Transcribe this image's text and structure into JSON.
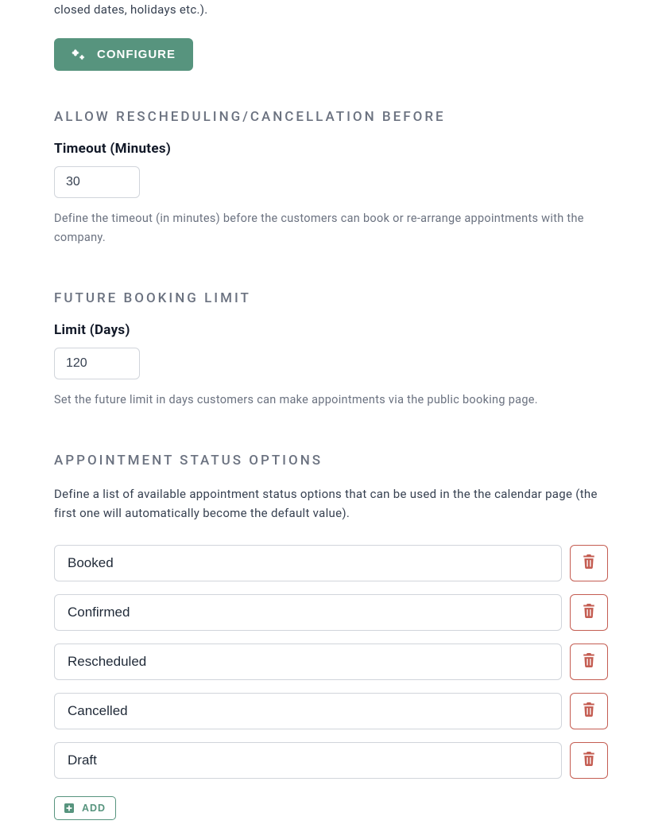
{
  "intro_fragment": "closed dates, holidays etc.).",
  "configure_label": "CONFIGURE",
  "sections": {
    "reschedule": {
      "heading": "ALLOW RESCHEDULING/CANCELLATION BEFORE",
      "field_label": "Timeout (Minutes)",
      "value": "30",
      "helper": "Define the timeout (in minutes) before the customers can book or re-arrange appointments with the company."
    },
    "future": {
      "heading": "FUTURE BOOKING LIMIT",
      "field_label": "Limit (Days)",
      "value": "120",
      "helper": "Set the future limit in days customers can make appointments via the public booking page."
    },
    "status": {
      "heading": "APPOINTMENT STATUS OPTIONS",
      "description": "Define a list of available appointment status options that can be used in the the calendar page (the first one will automatically become the default value).",
      "items": [
        "Booked",
        "Confirmed",
        "Rescheduled",
        "Cancelled",
        "Draft"
      ],
      "add_label": "ADD"
    }
  }
}
